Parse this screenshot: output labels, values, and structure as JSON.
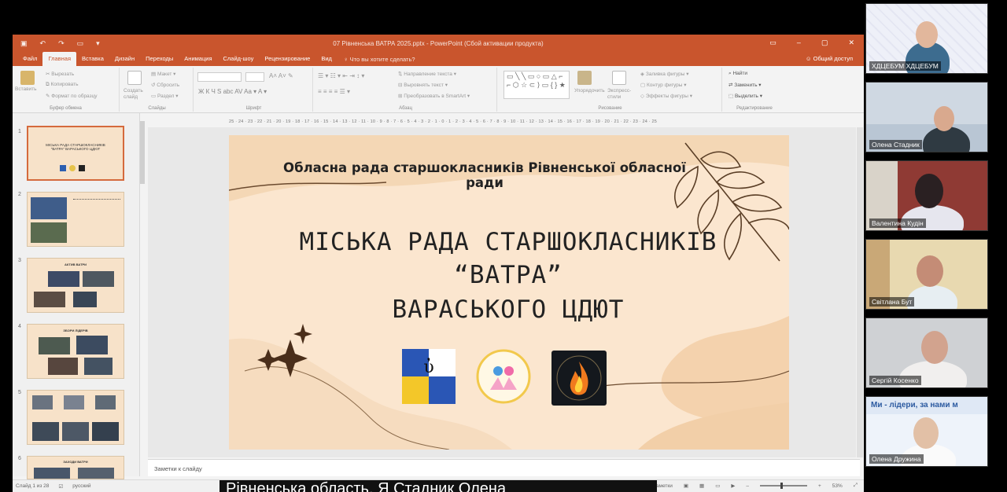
{
  "ppt": {
    "window_title": "07 Рівненська ВАТРА 2025.pptx - PowerPoint (Сбой активации продукта)",
    "menu_tabs": [
      "Файл",
      "Главная",
      "Вставка",
      "Дизайн",
      "Переходы",
      "Анимация",
      "Слайд-шоу",
      "Рецензирование",
      "Вид"
    ],
    "active_tab": "Главная",
    "tell_me": "Что вы хотите сделать?",
    "share": "Общий доступ",
    "ribbon": {
      "paste": "Вставить",
      "cut": "Вырезать",
      "copy": "Копировать",
      "format_painter": "Формат по образцу",
      "clipboard_group": "Буфер обмена",
      "new_slide": "Создать слайд",
      "layout": "Макет",
      "reset": "Сбросить",
      "section": "Раздел",
      "slides_group": "Слайды",
      "font_group": "Шрифт",
      "text_direction": "Направление текста",
      "align_text": "Выровнять текст",
      "convert_smartart": "Преобразовать в SmartArt",
      "paragraph_group": "Абзац",
      "arrange": "Упорядочить",
      "quick_styles": "Экспресс-стили",
      "shape_fill": "Заливка фигуры",
      "shape_outline": "Контур фигуры",
      "shape_effects": "Эффекты фигуры",
      "drawing_group": "Рисование",
      "find": "Найти",
      "replace": "Заменить",
      "select": "Выделить",
      "editing_group": "Редактирование"
    },
    "ruler": "25 · 24 · 23 · 22 · 21 · 20 · 19 · 18 · 17 · 16 · 15 · 14 · 13 · 12 · 11 · 10 · 9 · 8 · 7 · 6 · 5 · 4 · 3 · 2 · 1 · 0 · 1 · 2 · 3 · 4 · 5 · 6 · 7 · 8 · 9 · 10 · 11 · 12 · 13 · 14 · 15 · 16 · 17 · 18 · 19 · 20 · 21 · 22 · 23 · 24 · 25",
    "thumbnails": [
      {
        "num": "1",
        "title": "МІСЬКА РАДА СТАРШОКЛАСНИКІВ \"ВАТРА\" ВАРАСЬКОГО ЦДЮТ"
      },
      {
        "num": "2",
        "title": ""
      },
      {
        "num": "3",
        "title": "АКТИВ ВАТРИ"
      },
      {
        "num": "4",
        "title": "ЗБОРИ ЛІДЕРІВ"
      },
      {
        "num": "5",
        "title": ""
      },
      {
        "num": "6",
        "title": "ЗАХОДИ ВАТРИ"
      }
    ],
    "slide": {
      "subtitle": "Обласна рада старшокласників Рівненської обласної ради",
      "title_line1": "МІСЬКА РАДА СТАРШОКЛАСНИКІВ",
      "title_line2": "“ВАТРА”",
      "title_line3": "ВАРАСЬКОГО ЦДЮТ"
    },
    "notes_placeholder": "Заметки к слайду",
    "status": {
      "slide_counter": "Слайд 1 из 28",
      "language": "русский",
      "notes_btn": "Заметки",
      "zoom": "53%"
    }
  },
  "participants": [
    {
      "name": "ХДЦЕБУМ ХДЦЕБУМ"
    },
    {
      "name": "Олена Стадник"
    },
    {
      "name": "Валентина Кудін"
    },
    {
      "name": "Світлана Бут"
    },
    {
      "name": "Сергій Косенко"
    },
    {
      "name": "Олена Дружина",
      "banner": "Ми - лідери, за нами м"
    }
  ],
  "caption": "Рівненська область. Я Стадник Олена"
}
